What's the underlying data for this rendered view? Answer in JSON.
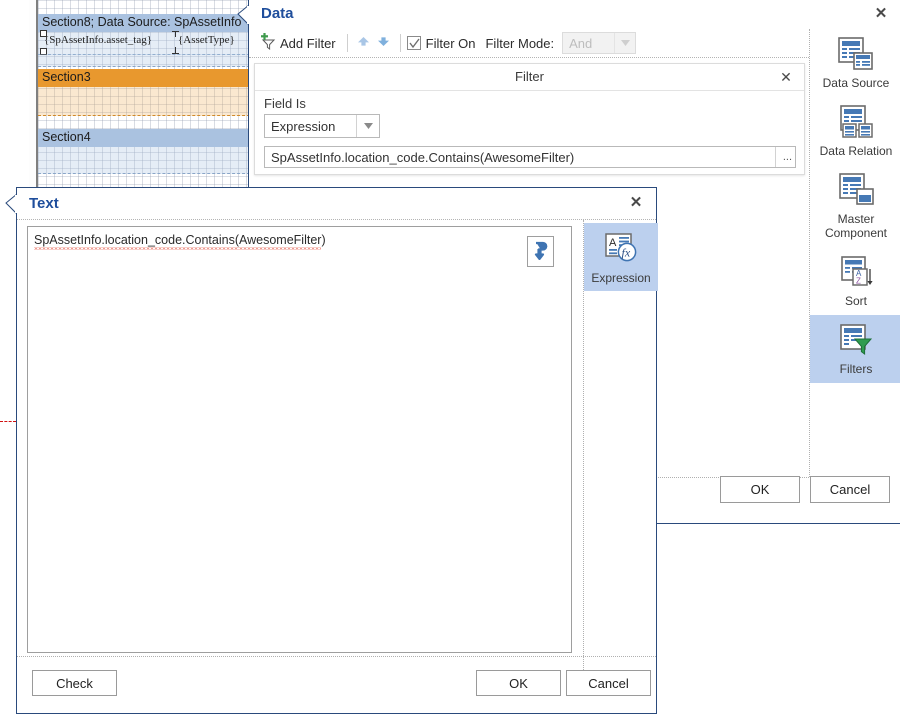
{
  "designer": {
    "sections": [
      {
        "title": "Section8; Data Source: SpAssetInfo",
        "style": "blue"
      },
      {
        "title": "Section3",
        "style": "orange"
      },
      {
        "title": "Section4",
        "style": "blue"
      }
    ],
    "fields": [
      {
        "label": "{SpAssetInfo.asset_tag}"
      },
      {
        "label": "{AssetType}"
      }
    ]
  },
  "data_dialog": {
    "title": "Data",
    "close_icon": "✕",
    "toolbar": {
      "add_filter_label": "Add Filter",
      "add_filter_icon": "add-filter-icon",
      "move_up_icon": "arrow-up-icon",
      "move_down_icon": "arrow-down-icon",
      "filter_on_label": "Filter On",
      "filter_on_checked": true,
      "filter_mode_label": "Filter Mode:",
      "filter_mode_value": "And",
      "filter_mode_enabled": false
    },
    "filter_card": {
      "title": "Filter",
      "close_icon": "✕",
      "field_is_label": "Field Is",
      "field_is_value": "Expression",
      "expression_value": "SpAssetInfo.location_code.Contains(AwesomeFilter)",
      "ellipsis_label": "..."
    },
    "rail": [
      {
        "label": "Data Source",
        "icon": "data-source-icon",
        "active": false
      },
      {
        "label": "Data Relation",
        "icon": "data-relation-icon",
        "active": false
      },
      {
        "label": "Master\nComponent",
        "icon": "master-component-icon",
        "active": false
      },
      {
        "label": "Sort",
        "icon": "sort-icon",
        "active": false
      },
      {
        "label": "Filters",
        "icon": "filters-icon",
        "active": true
      }
    ],
    "ok_label": "OK",
    "cancel_label": "Cancel"
  },
  "text_dialog": {
    "title": "Text",
    "close_icon": "✕",
    "editor_text_part1": "SpAssetInfo.location_code.Contains(",
    "editor_text_part2": "AwesomeFilter",
    "editor_text_part3": ")",
    "editor_full_text": "SpAssetInfo.location_code.Contains(AwesomeFilter)",
    "insert_icon": "insert-newline-arrow-icon",
    "rail": [
      {
        "label": "Expression",
        "icon": "expression-fx-icon",
        "active": true
      }
    ],
    "check_label": "Check",
    "ok_label": "OK",
    "cancel_label": "Cancel"
  },
  "colors": {
    "accent_blue": "#1f4e9c",
    "selection_blue": "#bcd0ee",
    "section_blue": "#aac2e0",
    "section_orange": "#e8982e",
    "border_blue": "#2a4a7c",
    "spell_error_red": "#e03b28"
  }
}
